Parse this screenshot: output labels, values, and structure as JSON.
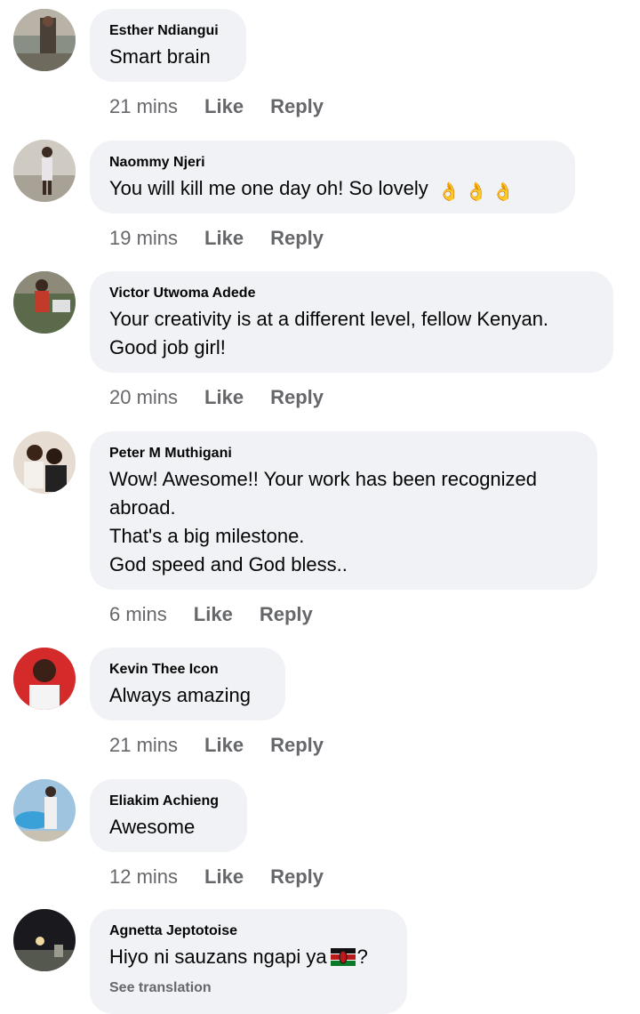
{
  "comments": [
    {
      "name": "Esther Ndiangui",
      "lines": [
        "Smart brain"
      ],
      "time": "21 mins",
      "like": "Like",
      "reply": "Reply"
    },
    {
      "name": "Naommy Njeri",
      "lines": [
        "You will kill me one day oh!  So lovely"
      ],
      "emoji": "👌 👌 👌",
      "time": "19 mins",
      "like": "Like",
      "reply": "Reply"
    },
    {
      "name": "Victor Utwoma Adede",
      "lines": [
        "Your creativity is at a different level, fellow Kenyan.",
        "Good job girl!"
      ],
      "time": "20 mins",
      "like": "Like",
      "reply": "Reply"
    },
    {
      "name": "Peter M Muthigani",
      "lines": [
        "Wow! Awesome!! Your work has been recognized",
        "abroad.",
        "That's a big milestone.",
        "God speed and God bless.."
      ],
      "time": "6 mins",
      "like": "Like",
      "reply": "Reply"
    },
    {
      "name": "Kevin Thee Icon",
      "lines": [
        "Always amazing"
      ],
      "time": "21 mins",
      "like": "Like",
      "reply": "Reply"
    },
    {
      "name": "Eliakim Achieng",
      "lines": [
        "Awesome"
      ],
      "time": "12 mins",
      "like": "Like",
      "reply": "Reply"
    },
    {
      "name": "Agnetta Jeptotoise",
      "text_before": "Hiyo ni sauzans ngapi ya",
      "flag": "kenya-flag-emoji",
      "text_after": "?",
      "see_translation": "See translation"
    }
  ],
  "colors": {
    "bubble": "#f0f2f5",
    "meta": "#65676b",
    "text": "#050505"
  }
}
